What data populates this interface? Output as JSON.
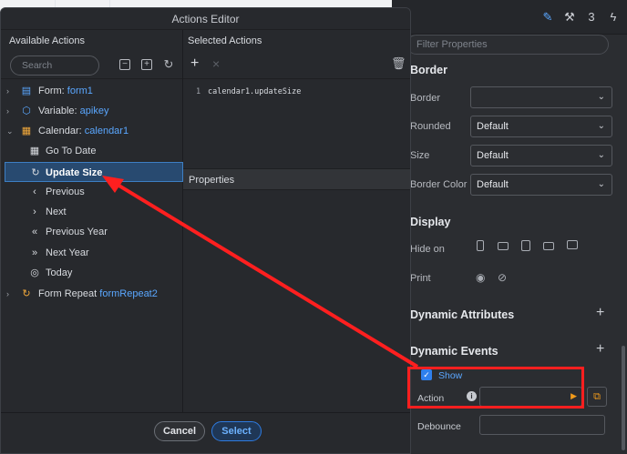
{
  "dialog": {
    "title": "Actions Editor",
    "available_label": "Available Actions",
    "selected_label": "Selected Actions",
    "search_placeholder": "Search",
    "properties_label": "Properties",
    "code_line_number": "1",
    "code_line": "calendar1.updateSize",
    "cancel_label": "Cancel",
    "select_label": "Select",
    "tree": [
      {
        "kind": "Form:",
        "name": "form1"
      },
      {
        "kind": "Variable:",
        "name": "apikey"
      },
      {
        "kind": "Calendar:",
        "name": "calendar1"
      },
      {
        "label": "Go To Date"
      },
      {
        "label": "Update Size"
      },
      {
        "label": "Previous"
      },
      {
        "label": "Next"
      },
      {
        "label": "Previous Year"
      },
      {
        "label": "Next Year"
      },
      {
        "label": "Today"
      },
      {
        "kind": "Form Repeat",
        "name": "formRepeat2"
      }
    ]
  },
  "panel": {
    "filter_placeholder": "Filter Properties",
    "border_title": "Border",
    "border_label": "Border",
    "rounded_label": "Rounded",
    "rounded_value": "Default",
    "size_label": "Size",
    "size_value": "Default",
    "border_color_label": "Border Color",
    "border_color_value": "Default",
    "display_title": "Display",
    "hide_on_label": "Hide on",
    "print_label": "Print",
    "dynamic_attributes": "Dynamic Attributes",
    "dynamic_events": "Dynamic Events",
    "show_label": "Show",
    "action_label": "Action",
    "debounce_label": "Debounce"
  },
  "colors": {
    "accent": "#5aa7ff",
    "annotation": "#ff1f1f"
  }
}
